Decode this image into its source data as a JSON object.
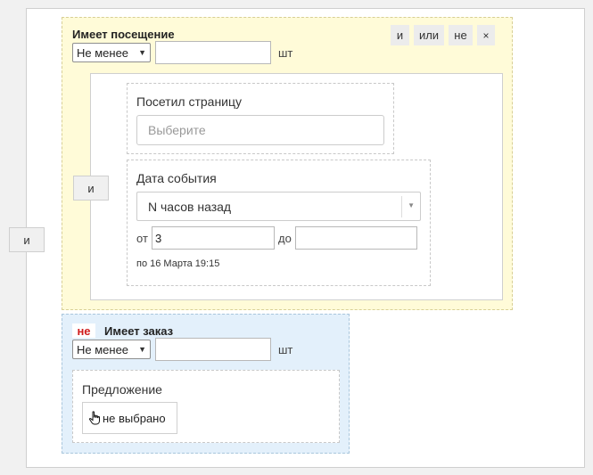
{
  "outer": {
    "join_label": "и"
  },
  "visit": {
    "title": "Имеет посещение",
    "buttons": {
      "and": "и",
      "or": "или",
      "not": "не",
      "close": "×"
    },
    "qty_operator": "Не менее",
    "qty_value": "",
    "qty_unit": "шт",
    "inner_join_label": "и",
    "page_visit": {
      "label": "Посетил страницу",
      "placeholder": "Выберите"
    },
    "event_date": {
      "label": "Дата события",
      "mode": "N часов назад",
      "from_label": "от",
      "from_value": "3",
      "to_label": "до",
      "to_value": "",
      "hint": "по 16 Марта 19:15"
    }
  },
  "order": {
    "not_badge": "не",
    "title": "Имеет заказ",
    "qty_operator": "Не менее",
    "qty_value": "",
    "qty_unit": "шт",
    "offer": {
      "label": "Предложение",
      "button": "не выбрано"
    }
  },
  "icons": {
    "select_chevron": "chevron-down-icon",
    "hand_pointer": "hand-pointer-icon"
  },
  "colors": {
    "visit_bg": "#fffbd8",
    "order_bg": "#e3f0fb",
    "not_red": "#d01b1b"
  }
}
